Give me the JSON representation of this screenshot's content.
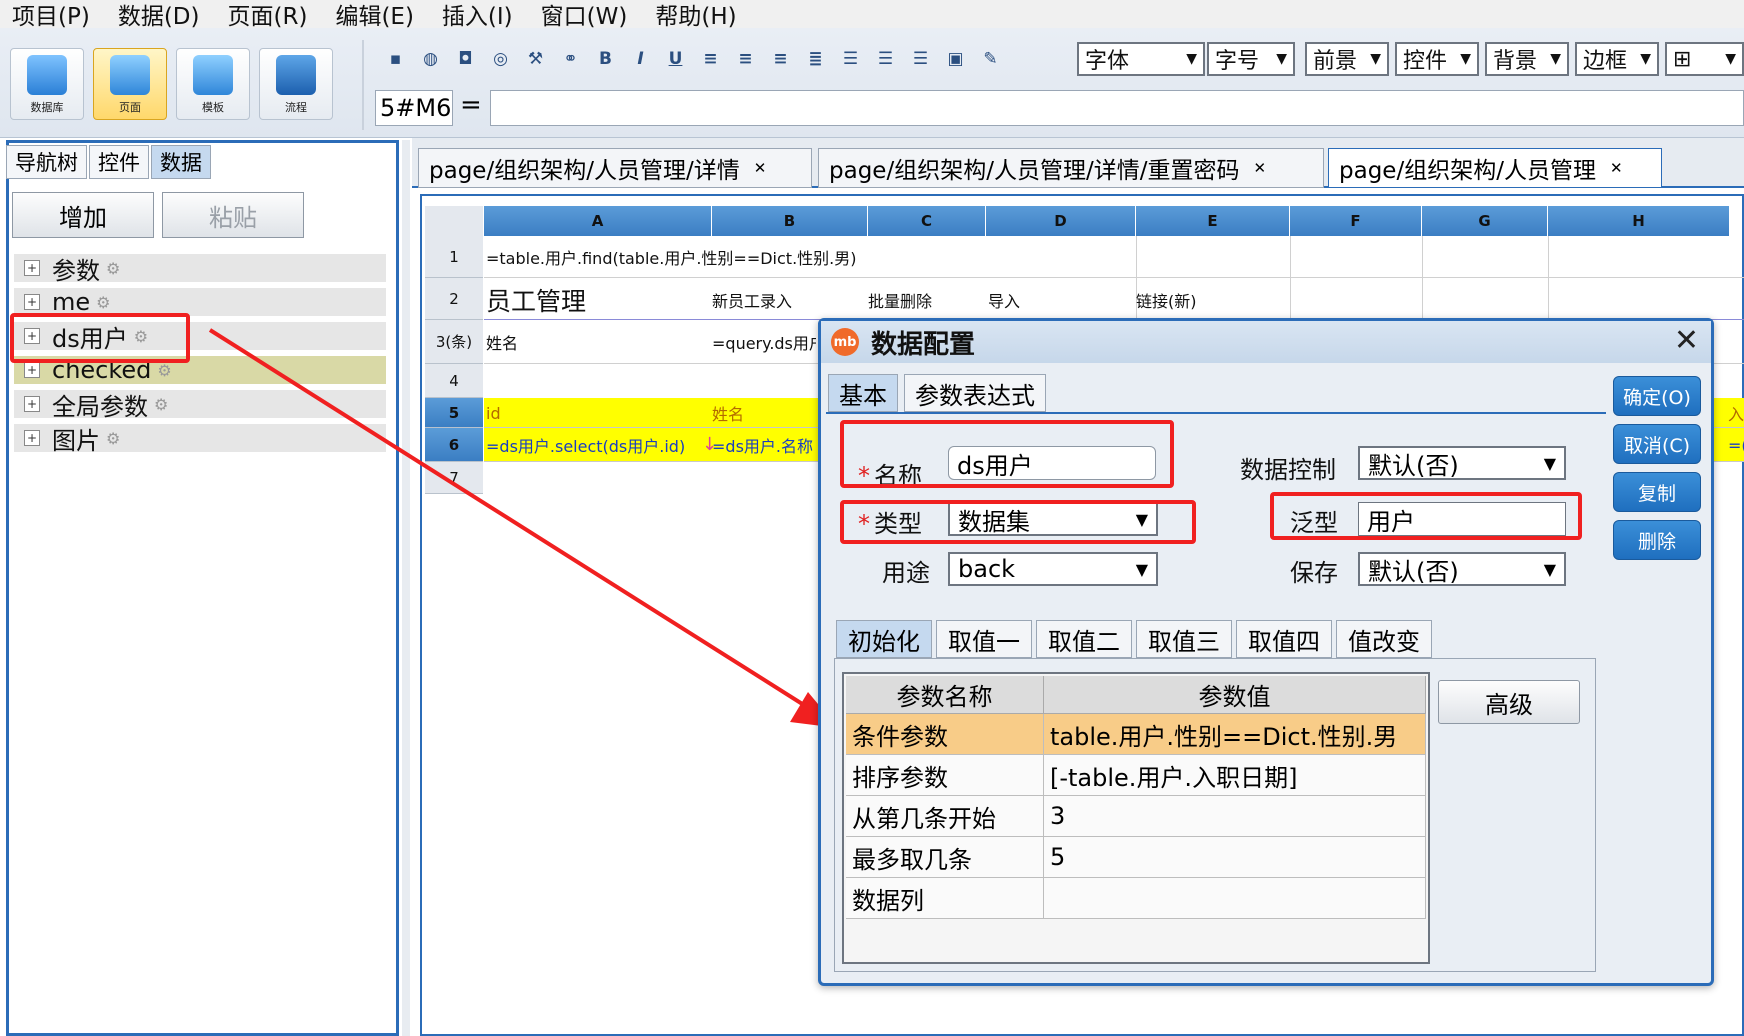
{
  "menu": [
    "项目(P)",
    "数据(D)",
    "页面(R)",
    "编辑(E)",
    "插入(I)",
    "窗口(W)",
    "帮助(H)"
  ],
  "big_buttons": [
    "数据库",
    "页面",
    "模板",
    "流程"
  ],
  "toolbar_combos": [
    "字体",
    "字号",
    "前景",
    "控件",
    "背景",
    "边框"
  ],
  "cell_ref": "5#M6",
  "formula_eq": "=",
  "left_tabs": [
    "导航树",
    "控件",
    "数据"
  ],
  "left_buttons": {
    "add": "增加",
    "paste": "粘贴"
  },
  "tree": [
    "参数",
    "me",
    "ds用户",
    "checked",
    "全局参数",
    "图片"
  ],
  "page_tabs": [
    "page/组织架构/人员管理/详情",
    "page/组织架构/人员管理/详情/重置密码",
    "page/组织架构/人员管理"
  ],
  "columns": [
    "A",
    "B",
    "C",
    "D",
    "E",
    "F",
    "G",
    "H"
  ],
  "rows": [
    "1",
    "2",
    "3(条)",
    "4",
    "5",
    "6",
    "7"
  ],
  "cells": {
    "r1a": "=table.用户.find(table.用户.性别==Dict.性别.男)",
    "r2a": "员工管理",
    "r2b": "新员工录入",
    "r2c": "批量删除",
    "r2d": "导入",
    "r2e": "链接(新)",
    "r3a": "姓名",
    "r3b": "=query.ds用户",
    "r5a": "id",
    "r5b": "姓名",
    "r5i": "入",
    "r6a": "=ds用户.select(ds用户.id)",
    "r6b": "=ds用户.名称",
    "r6i": "=("
  },
  "dialog": {
    "title": "数据配置",
    "logo": "mb",
    "close": "✕",
    "tabs": [
      "基本",
      "参数表达式"
    ],
    "name_label": "名称",
    "name_value": "ds用户",
    "type_label": "类型",
    "type_value": "数据集",
    "use_label": "用途",
    "use_value": "back",
    "datactrl_label": "数据控制",
    "datactrl_value": "默认(否)",
    "generic_label": "泛型",
    "generic_value": "用户",
    "save_label": "保存",
    "save_value": "默认(否)",
    "buttons": [
      "确定(O)",
      "取消(C)",
      "复制",
      "删除"
    ],
    "subtabs": [
      "初始化",
      "取值一",
      "取值二",
      "取值三",
      "取值四",
      "值改变"
    ],
    "table_headers": [
      "参数名称",
      "参数值"
    ],
    "params": [
      {
        "name": "条件参数",
        "value": "table.用户.性别==Dict.性别.男"
      },
      {
        "name": "排序参数",
        "value": "[-table.用户.入职日期]"
      },
      {
        "name": "从第几条开始",
        "value": "3"
      },
      {
        "name": "最多取几条",
        "value": "5"
      },
      {
        "name": "数据列",
        "value": ""
      }
    ],
    "advanced": "高级"
  },
  "colors": {
    "accent": "#2b6cb8",
    "highlight_red": "#f02020",
    "yellow": "#ffff00"
  }
}
